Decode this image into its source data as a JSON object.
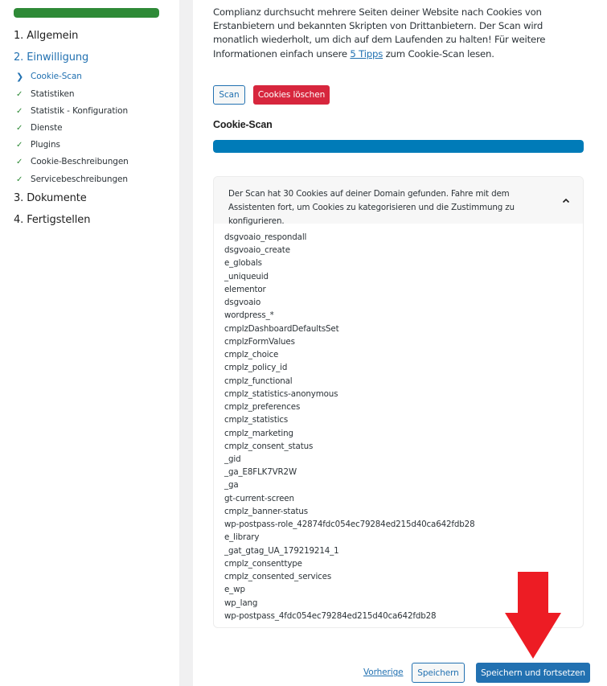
{
  "sidebar": {
    "progress_percent": 100,
    "progress_color": "#2e8a37",
    "steps": [
      {
        "label": "1. Allgemein",
        "active": false
      },
      {
        "label": "2. Einwilligung",
        "active": true
      },
      {
        "label": "3. Dokumente",
        "active": false
      },
      {
        "label": "4. Fertigstellen",
        "active": false
      }
    ],
    "substeps": [
      {
        "label": "Cookie-Scan",
        "icon": "chevron-right-icon",
        "active": true
      },
      {
        "label": "Statistiken",
        "icon": "check-icon",
        "active": false
      },
      {
        "label": "Statistik - Konfiguration",
        "icon": "check-icon",
        "active": false
      },
      {
        "label": "Dienste",
        "icon": "check-icon",
        "active": false
      },
      {
        "label": "Plugins",
        "icon": "check-icon",
        "active": false
      },
      {
        "label": "Cookie-Beschreibungen",
        "icon": "check-icon",
        "active": false
      },
      {
        "label": "Servicebeschreibungen",
        "icon": "check-icon",
        "active": false
      }
    ]
  },
  "main": {
    "intro_before_link": "Complianz durchsucht mehrere Seiten deiner Website nach Cookies von Erstanbietern und bekannten Skripten von Drittanbietern. Der Scan wird monatlich wiederholt, um dich auf dem Laufenden zu halten! Für weitere Informationen einfach unsere ",
    "intro_link": "5 Tipps",
    "intro_after_link": " zum Cookie-Scan lesen.",
    "scan_button": "Scan",
    "delete_button": "Cookies löschen",
    "scan_title": "Cookie-Scan",
    "scan_progress_percent": 100,
    "colors": {
      "primary": "#2271b1",
      "danger": "#d7263d",
      "scan_progress": "#007bb8"
    },
    "results": {
      "summary": "Der Scan hat  30  Cookies auf deiner Domain gefunden. Fahre mit dem Assistenten fort, um Cookies zu kategorisieren und die Zustimmung zu konfigurieren.",
      "count": 30,
      "cookies": [
        "dsgvoaio_respondall",
        "dsgvoaio_create",
        "e_globals",
        "_uniqueuid",
        "elementor",
        "dsgvoaio",
        "wordpress_*",
        "cmplzDashboardDefaultsSet",
        "cmplzFormValues",
        "cmplz_choice",
        "cmplz_policy_id",
        "cmplz_functional",
        "cmplz_statistics-anonymous",
        "cmplz_preferences",
        "cmplz_statistics",
        "cmplz_marketing",
        "cmplz_consent_status",
        "_gid",
        "_ga_E8FLK7VR2W",
        "_ga",
        "gt-current-screen",
        "cmplz_banner-status",
        "wp-postpass-role_42874fdc054ec79284ed215d40ca642fdb28",
        "e_library",
        "_gat_gtag_UA_179219214_1",
        "cmplz_consenttype",
        "cmplz_consented_services",
        "e_wp",
        "wp_lang",
        "wp-postpass_4fdc054ec79284ed215d40ca642fdb28"
      ]
    },
    "footer": {
      "previous_link": "Vorherige",
      "save_button": "Speichern",
      "save_continue_button": "Speichern und fortsetzen"
    }
  },
  "annotation": {
    "arrow_color": "#ed1c24"
  }
}
